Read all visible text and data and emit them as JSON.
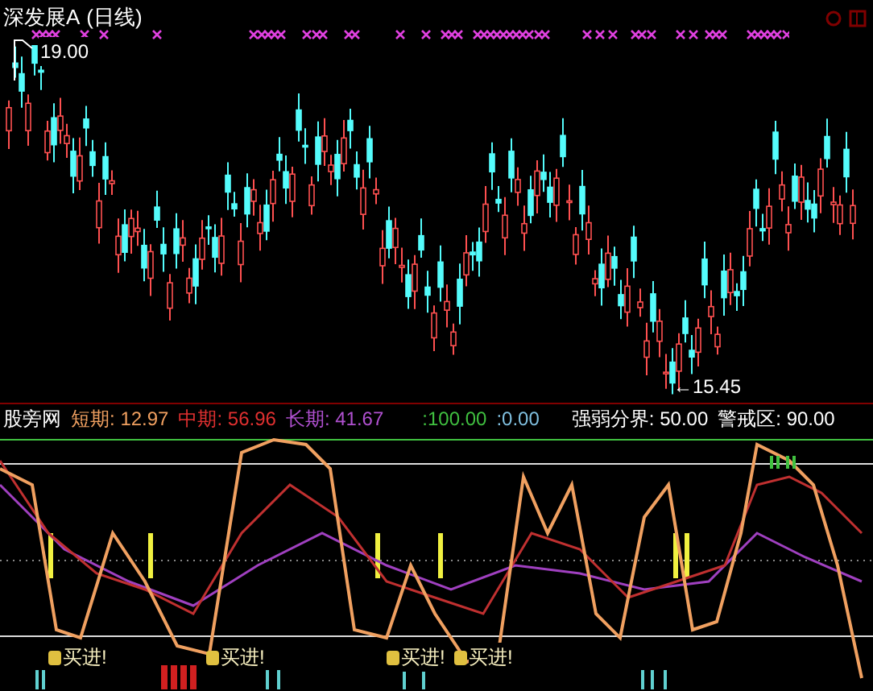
{
  "title": "深发展A",
  "period": "(日线)",
  "price_high": "19.00",
  "price_low": "←15.45",
  "indicator": {
    "name": "股旁网",
    "items": [
      {
        "label": "短期:",
        "value": "12.97",
        "color": "#f0a060"
      },
      {
        "label": "中期:",
        "value": "56.96",
        "color": "#e03030"
      },
      {
        "label": "长期:",
        "value": "41.67",
        "color": "#b050d0"
      }
    ],
    "outputs": [
      {
        "text": ":100.00",
        "color": "#40c040"
      },
      {
        "text": ":0.00",
        "color": "#80c0e0"
      }
    ],
    "thresholds": [
      {
        "label": "强弱分界:",
        "value": "50.00"
      },
      {
        "label": "警戒区:",
        "value": "90.00"
      }
    ]
  },
  "signals": [
    {
      "text": "买进!"
    },
    {
      "text": "买进!"
    },
    {
      "text": "买进!"
    },
    {
      "text": "买进!"
    }
  ]
}
